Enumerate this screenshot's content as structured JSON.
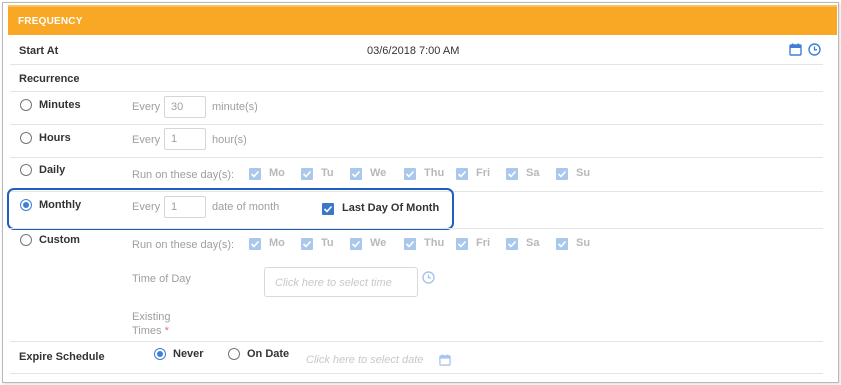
{
  "header": {
    "title": "FREQUENCY"
  },
  "start": {
    "label": "Start At",
    "value": "03/6/2018 7:00 AM"
  },
  "recurrence": {
    "label": "Recurrence",
    "minutes": {
      "label": "Minutes",
      "every": "Every",
      "value": "30",
      "unit": "minute(s)"
    },
    "hours": {
      "label": "Hours",
      "every": "Every",
      "value": "1",
      "unit": "hour(s)"
    },
    "daily": {
      "label": "Daily",
      "run_label": "Run on these day(s):"
    },
    "monthly": {
      "label": "Monthly",
      "every": "Every",
      "value": "1",
      "unit": "date of month",
      "last_day_label": "Last Day Of Month"
    },
    "custom": {
      "label": "Custom",
      "run_label": "Run on these day(s):",
      "time_label": "Time of Day",
      "time_placeholder": "Click here to select time",
      "existing_label": "Existing Times",
      "required_mark": "*"
    },
    "days": [
      "Mo",
      "Tu",
      "We",
      "Thu",
      "Fri",
      "Sa",
      "Su"
    ]
  },
  "expire": {
    "label": "Expire Schedule",
    "never": "Never",
    "on_date": "On Date",
    "date_placeholder": "Click here to select date"
  },
  "colors": {
    "header": "#f9a825",
    "accent": "#3f7fd6",
    "highlight": "#1f5fbf"
  }
}
